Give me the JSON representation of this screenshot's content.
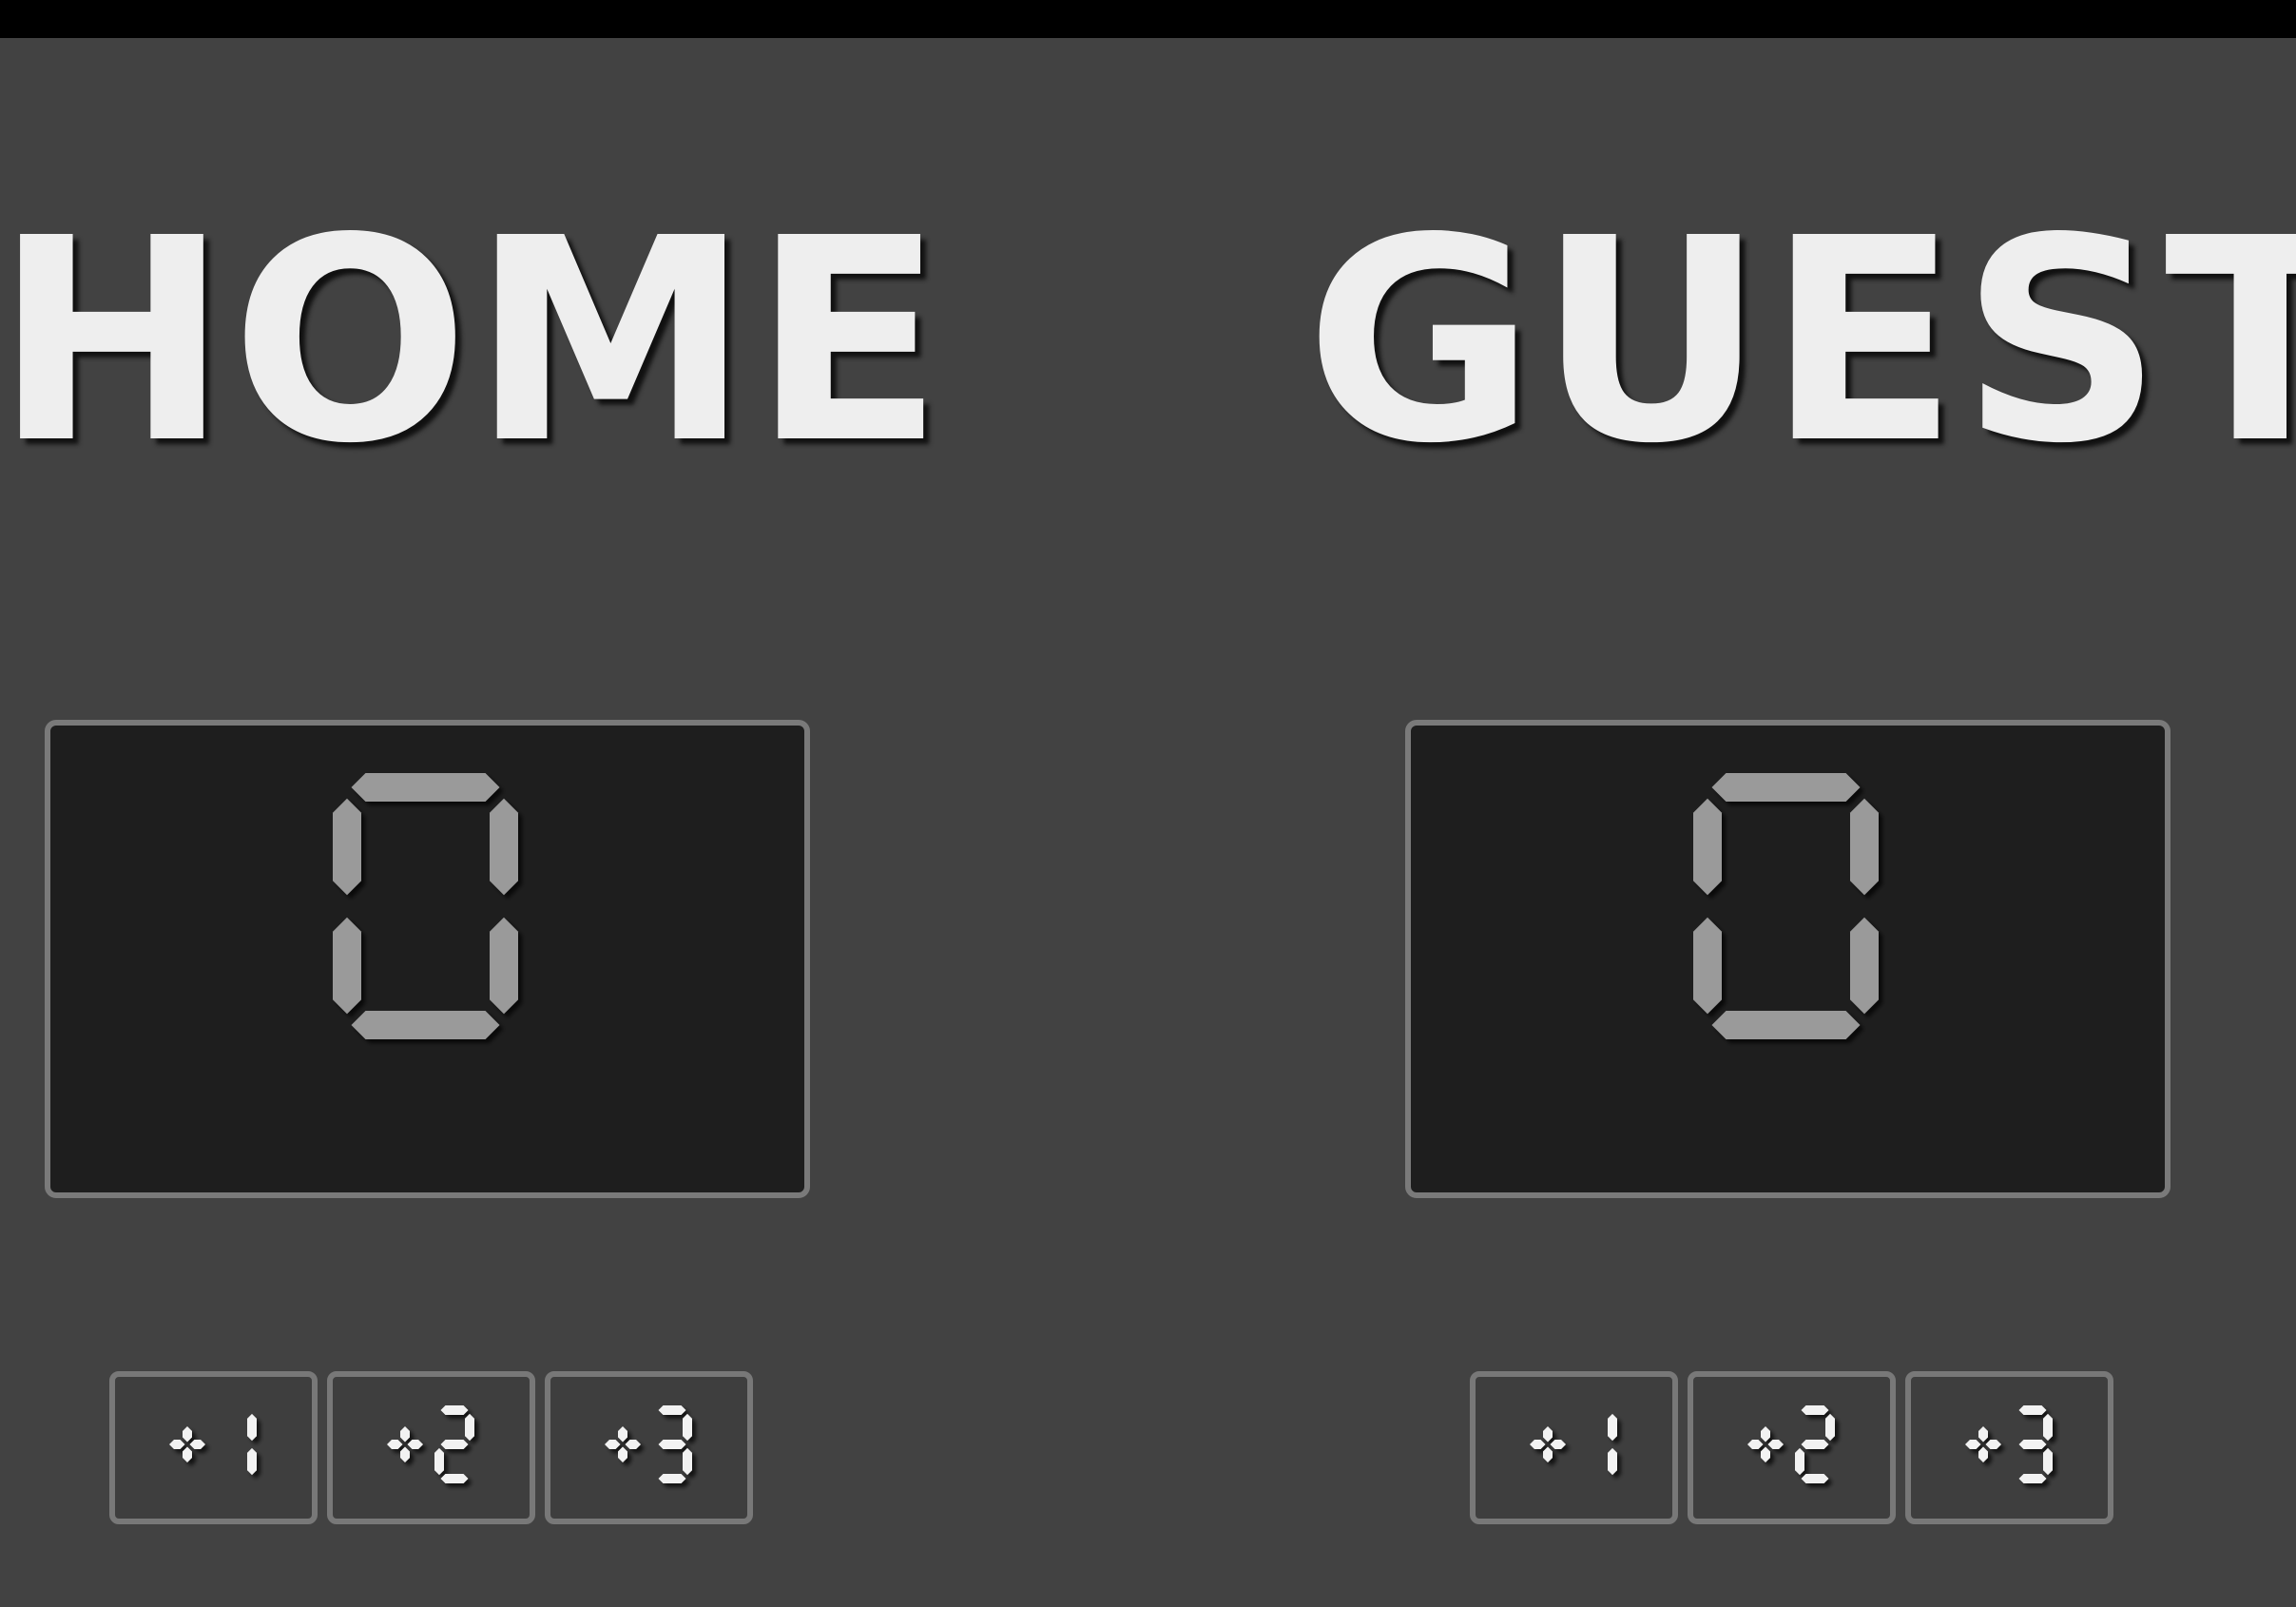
{
  "home": {
    "title": "HOME",
    "score": "0",
    "buttons": [
      "+1",
      "+2",
      "+3"
    ]
  },
  "guest": {
    "title": "GUEST",
    "score": "0",
    "buttons": [
      "+1",
      "+2",
      "+3"
    ]
  },
  "colors": {
    "background": "#424242",
    "top_bar": "#000000",
    "title_text": "#eeeeee",
    "score_panel": "#1e1e1e",
    "panel_border": "#7a7a7a",
    "score_digit": "#9a9a9a",
    "button_digit": "#f2f2f2"
  }
}
